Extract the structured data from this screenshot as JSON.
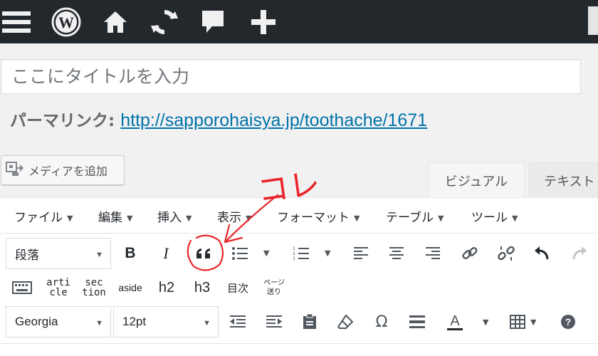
{
  "adminbar": {
    "icons": [
      "menu-icon",
      "wordpress-logo-icon",
      "home-icon",
      "updates-icon",
      "comments-icon",
      "new-content-icon"
    ]
  },
  "title": {
    "placeholder": "ここにタイトルを入力",
    "value": ""
  },
  "permalink": {
    "label": "パーマリンク:",
    "url": "http://sapporohaisya.jp/toothache/1671"
  },
  "media_button": {
    "label": "メディアを追加"
  },
  "tabs": {
    "visual": "ビジュアル",
    "text": "テキスト"
  },
  "menubar": [
    {
      "label": "ファイル"
    },
    {
      "label": "編集"
    },
    {
      "label": "挿入"
    },
    {
      "label": "表示"
    },
    {
      "label": "フォーマット"
    },
    {
      "label": "テーブル"
    },
    {
      "label": "ツール"
    }
  ],
  "toolbar1": {
    "format_select": "段落",
    "bold": "B",
    "italic": "I"
  },
  "toolbar2": {
    "article_top": "arti",
    "article_bottom": "cle",
    "section_top": "sec",
    "section_bottom": "tion",
    "aside": "aside",
    "h2": "h2",
    "h3": "h3",
    "toc": "目次",
    "pagebreak_top": "ページ",
    "pagebreak_bottom": "送り"
  },
  "toolbar3": {
    "font_family": "Georgia",
    "font_size": "12pt"
  },
  "annotation": {
    "text": "コレ",
    "color": "#e8262a"
  }
}
